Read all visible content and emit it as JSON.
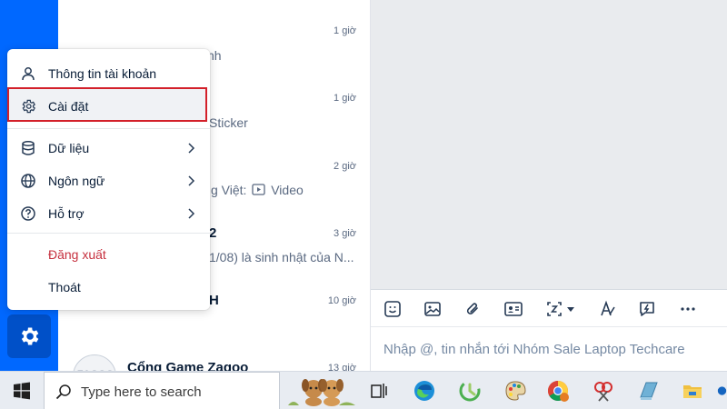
{
  "menu": {
    "items": [
      {
        "label": "Thông tin tài khoản",
        "icon": "user-icon"
      },
      {
        "label": "Cài đặt",
        "icon": "gear-icon",
        "highlighted": true
      },
      {
        "label": "Dữ liệu",
        "icon": "database-icon",
        "submenu": true
      },
      {
        "label": "Ngôn ngữ",
        "icon": "globe-icon",
        "submenu": true
      },
      {
        "label": "Hỗ trợ",
        "icon": "help-icon",
        "submenu": true
      },
      {
        "label": "Đăng xuất",
        "color": "#c6303e"
      },
      {
        "label": "Thoát"
      }
    ],
    "highlight_color": "#d3202a"
  },
  "conversations": [
    {
      "time": "1 giờ",
      "snippet": "nh"
    },
    {
      "time": "1 giờ",
      "snippet": "Sticker"
    },
    {
      "time": "2 giờ",
      "snippet_prefix": "g Việt:",
      "snippet_suffix": "Video"
    },
    {
      "time": "3 giờ",
      "title": "2",
      "snippet": "1/08) là sinh nhật của N..."
    },
    {
      "time": "10 giờ",
      "title": "H"
    },
    {
      "time": "13 giờ",
      "title": "Cổng Game Zagoo"
    }
  ],
  "composer": {
    "placeholder": "Nhập @, tin nhắn tới Nhóm Sale Laptop Techcare"
  },
  "taskbar": {
    "search_placeholder": "Type here to search"
  },
  "colors": {
    "sidebar": "#0068ff",
    "chat_bg": "#e9ebee"
  }
}
